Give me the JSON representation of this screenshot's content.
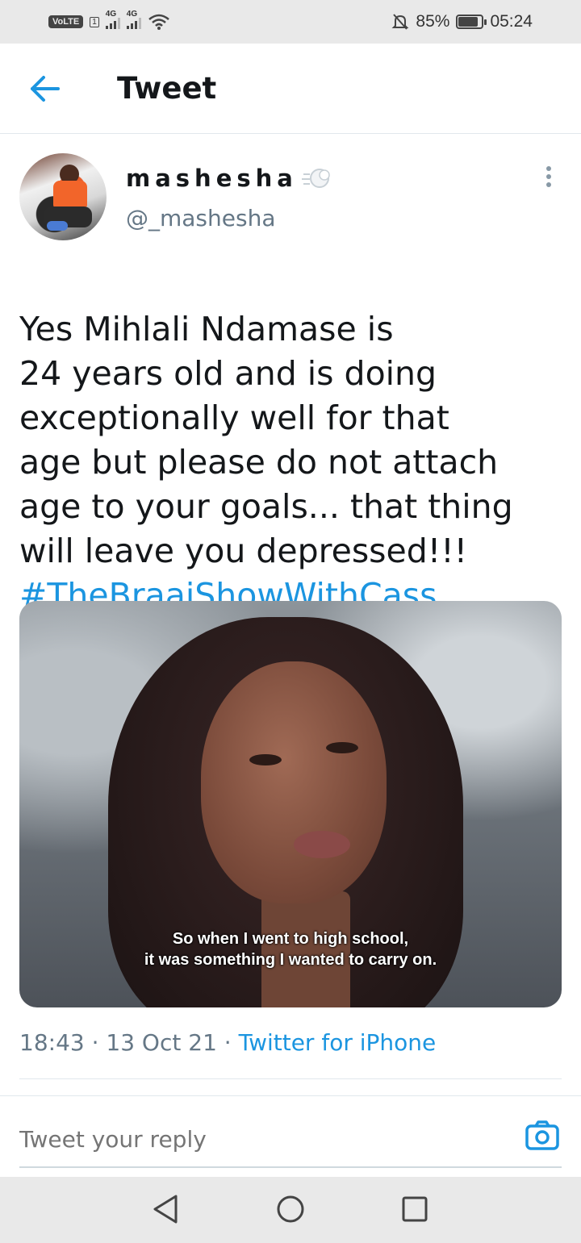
{
  "status_bar": {
    "volte": "VoLTE",
    "sim": "1",
    "net1": "4G",
    "net2": "4G",
    "battery_percent": "85%",
    "battery_level": 0.85,
    "time": "05:24"
  },
  "header": {
    "title": "Tweet",
    "back_icon": "arrow-left-icon"
  },
  "tweet": {
    "display_name": "mashesha",
    "handle": "@_mashesha",
    "text": "Yes Mihlali Ndamase is\n24 years old and is doing\nexceptionally well for that\nage but please do not attach\nage to your goals... that thing\nwill leave you depressed!!!",
    "hashtag": "#TheBraaiShowWithCass",
    "media_caption": "So when I went to high school,\nit was something I wanted to carry on.",
    "time": "18:43",
    "date": "13 Oct 21",
    "separator": " · ",
    "source": "Twitter for iPhone"
  },
  "reply": {
    "placeholder": "Tweet your reply"
  },
  "colors": {
    "accent": "#1b95e0",
    "secondary_text": "#657786",
    "divider": "#e1e8ed"
  }
}
